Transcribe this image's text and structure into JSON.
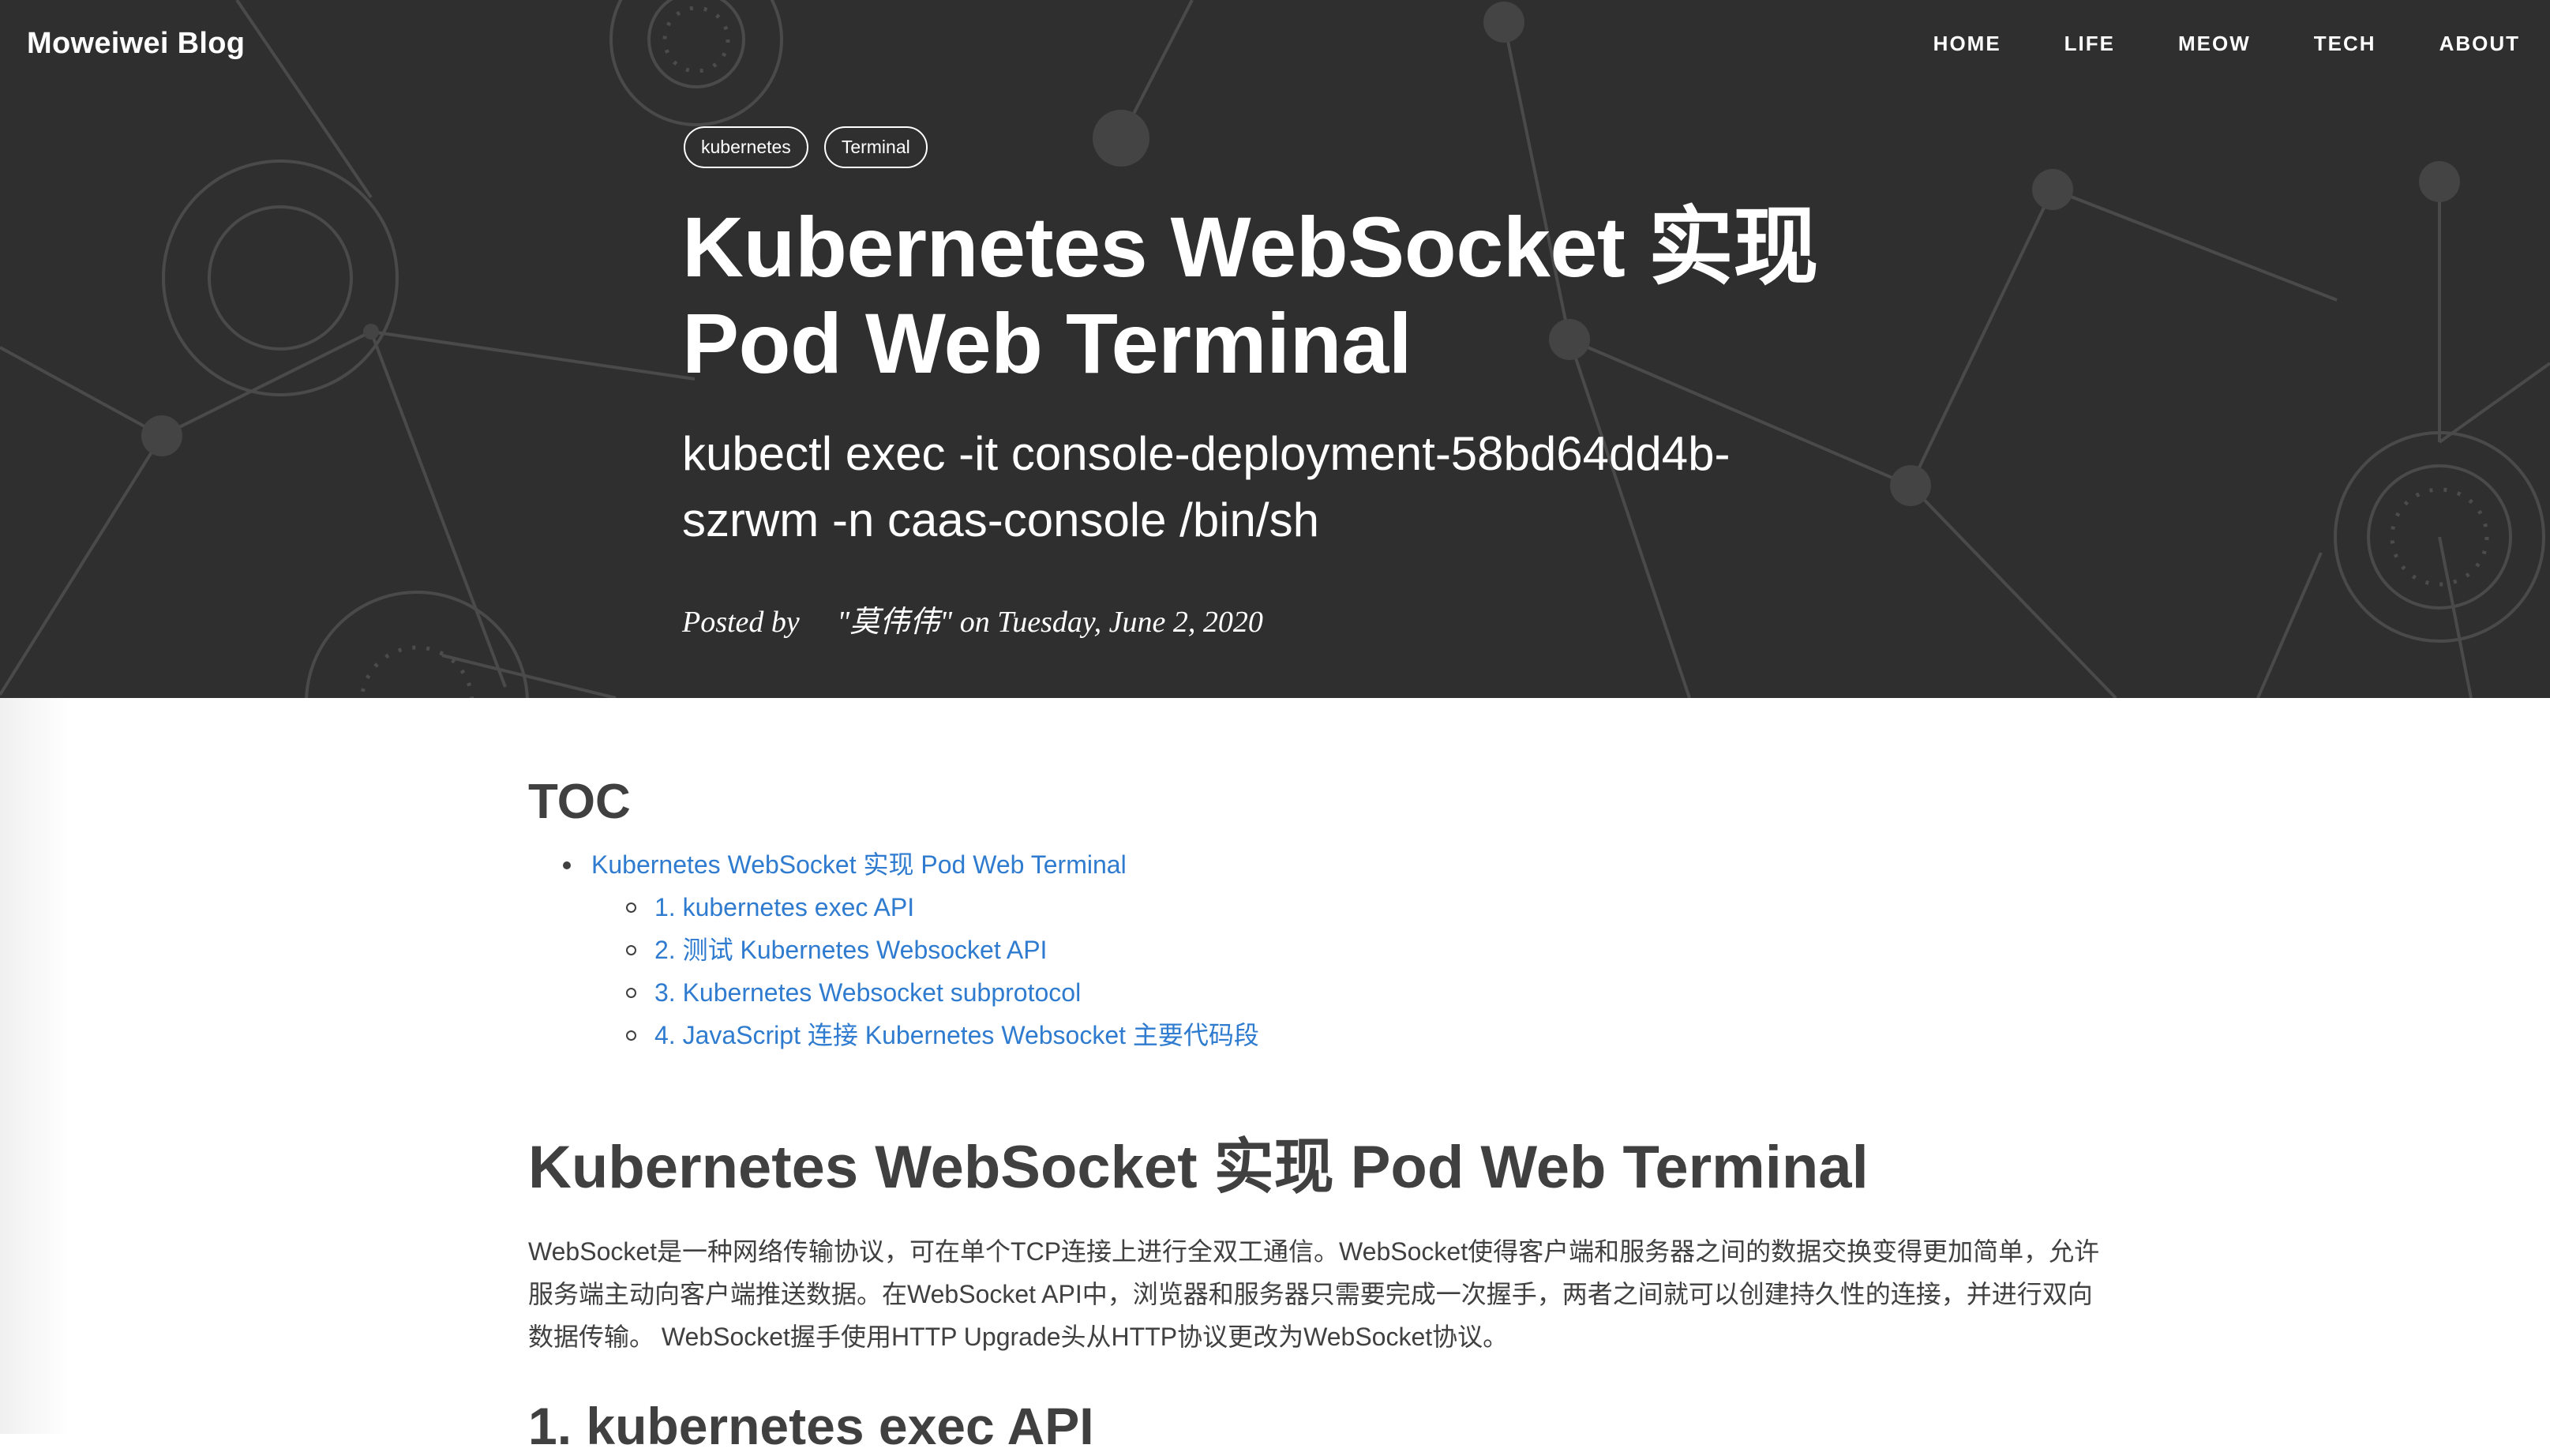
{
  "site": {
    "brand": "Moweiwei Blog",
    "nav": [
      "HOME",
      "LIFE",
      "MEOW",
      "TECH",
      "ABOUT"
    ]
  },
  "post": {
    "tags": [
      "kubernetes",
      "Terminal"
    ],
    "title": "Kubernetes WebSocket 实现 Pod Web Terminal",
    "subtitle": "kubectl exec -it console-deployment-58bd64dd4b-szrwm -n caas-console /bin/sh",
    "meta": "Posted by     \"莫伟伟\" on Tuesday, June 2, 2020"
  },
  "toc": {
    "title": "TOC",
    "items": [
      "Kubernetes WebSocket 实现 Pod Web Terminal",
      "1. kubernetes exec API",
      "2. 测试 Kubernetes Websocket API",
      "3. Kubernetes Websocket subprotocol",
      "4. JavaScript 连接 Kubernetes Websocket 主要代码段"
    ]
  },
  "article": {
    "heading": "Kubernetes WebSocket 实现 Pod Web Terminal",
    "paragraph": "WebSocket是一种网络传输协议，可在单个TCP连接上进行全双工通信。WebSocket使得客户端和服务器之间的数据交换变得更加简单，允许服务端主动向客户端推送数据。在WebSocket API中，浏览器和服务器只需要完成一次握手，两者之间就可以创建持久性的连接，并进行双向数据传输。 WebSocket握手使用HTTP Upgrade头从HTTP协议更改为WebSocket协议。",
    "subheading": "1. kubernetes exec API"
  },
  "colors": {
    "hero_bg": "#2f2f2f",
    "link": "#2e7bcf",
    "text": "#404040"
  }
}
